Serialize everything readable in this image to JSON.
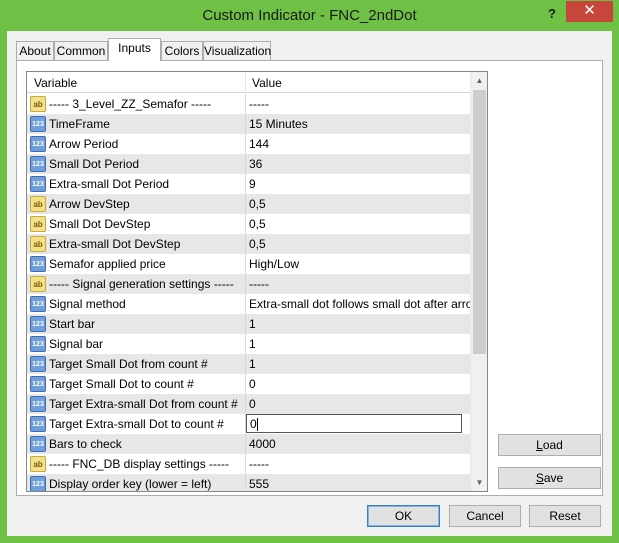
{
  "window": {
    "title": "Custom Indicator - FNC_2ndDot",
    "help_label": "?",
    "close_label": "✕"
  },
  "tabs": [
    {
      "label": "About"
    },
    {
      "label": "Common"
    },
    {
      "label": "Inputs"
    },
    {
      "label": "Colors"
    },
    {
      "label": "Visualization"
    }
  ],
  "grid": {
    "col_variable": "Variable",
    "col_value": "Value",
    "rows": [
      {
        "type": "ab",
        "name": "----- 3_Level_ZZ_Semafor -----",
        "value": "-----"
      },
      {
        "type": "123",
        "name": "TimeFrame",
        "value": "15 Minutes"
      },
      {
        "type": "123",
        "name": "Arrow Period",
        "value": "144"
      },
      {
        "type": "123",
        "name": "Small Dot Period",
        "value": "36"
      },
      {
        "type": "123",
        "name": "Extra-small Dot Period",
        "value": "9"
      },
      {
        "type": "ab",
        "name": "Arrow DevStep",
        "value": "0,5"
      },
      {
        "type": "ab",
        "name": "Small Dot DevStep",
        "value": "0,5"
      },
      {
        "type": "ab",
        "name": "Extra-small Dot DevStep",
        "value": "0,5"
      },
      {
        "type": "123",
        "name": "Semafor applied price",
        "value": "High/Low"
      },
      {
        "type": "ab",
        "name": "----- Signal generation settings -----",
        "value": "-----"
      },
      {
        "type": "123",
        "name": "Signal method",
        "value": "Extra-small dot follows small dot after arrow"
      },
      {
        "type": "123",
        "name": "Start bar",
        "value": "1"
      },
      {
        "type": "123",
        "name": "Signal bar",
        "value": "1"
      },
      {
        "type": "123",
        "name": "Target Small Dot from count #",
        "value": "1"
      },
      {
        "type": "123",
        "name": "Target Small Dot to count #",
        "value": "0"
      },
      {
        "type": "123",
        "name": "Target Extra-small Dot from count #",
        "value": "0"
      },
      {
        "type": "123",
        "name": "Target Extra-small Dot to count #",
        "value": "0"
      },
      {
        "type": "123",
        "name": "Bars to check",
        "value": "4000"
      },
      {
        "type": "ab",
        "name": "----- FNC_DB display settings -----",
        "value": "-----"
      },
      {
        "type": "123",
        "name": "Display order key (lower = left)",
        "value": "555"
      }
    ]
  },
  "buttons": {
    "load": {
      "accel": "L",
      "rest": "oad"
    },
    "save": {
      "accel": "S",
      "rest": "ave"
    },
    "ok": "OK",
    "cancel": "Cancel",
    "reset": "Reset"
  }
}
